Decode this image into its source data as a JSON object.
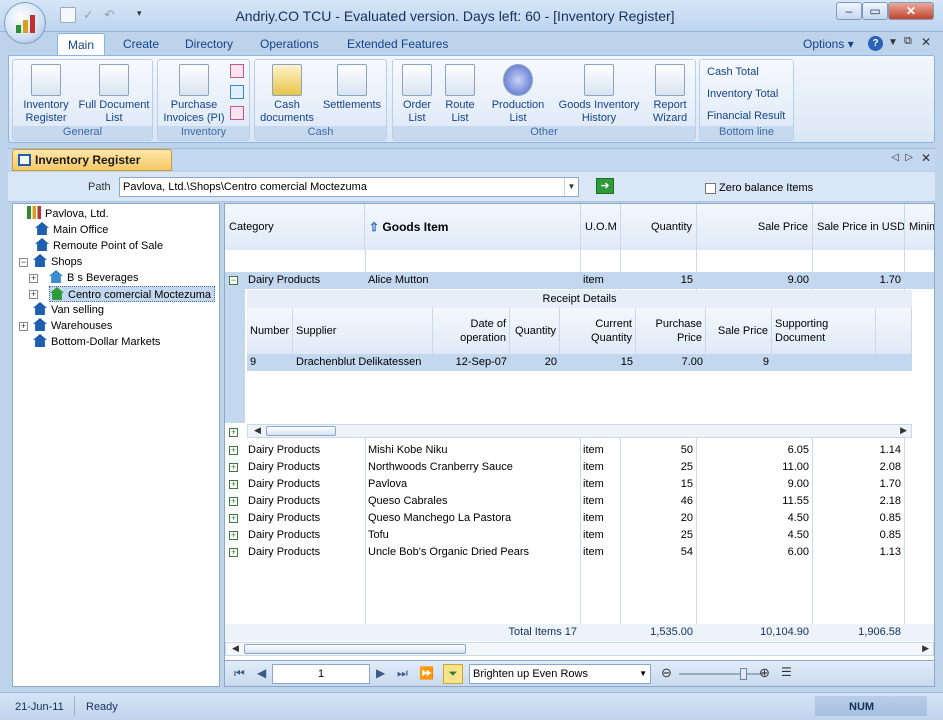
{
  "window": {
    "title": "Andriy.CO TCU - Evaluated version. Days left: 60 - [Inventory Register]"
  },
  "ribbon_tabs": [
    "Main",
    "Create",
    "Directory",
    "Operations",
    "Extended Features"
  ],
  "options_label": "Options",
  "groups": {
    "general": {
      "label": "General",
      "buttons": [
        "Inventory Register",
        "Full Document List"
      ]
    },
    "inventory": {
      "label": "Inventory",
      "buttons": [
        "Purchase Invoices (PI)"
      ]
    },
    "cash": {
      "label": "Cash",
      "buttons": [
        "Cash documents",
        "Settlements"
      ]
    },
    "other": {
      "label": "Other",
      "buttons": [
        "Order List",
        "Route List",
        "Production List",
        "Goods Inventory History",
        "Report Wizard"
      ]
    },
    "bottom_line": {
      "label": "Bottom line",
      "links": [
        "Cash Total",
        "Inventory Total",
        "Financial Result"
      ]
    }
  },
  "doc_tab": "Inventory Register",
  "path": {
    "label": "Path",
    "value": "Pavlova, Ltd.\\Shops\\Centro comercial Moctezuma"
  },
  "zero_balance_label": "Zero balance Items",
  "tree": [
    {
      "label": "Pavlova, Ltd.",
      "level": 0,
      "expander": ""
    },
    {
      "label": "Main Office",
      "level": 1,
      "expander": ""
    },
    {
      "label": "Remoute Point of Sale",
      "level": 1,
      "expander": ""
    },
    {
      "label": "Shops",
      "level": 0,
      "expander": "−"
    },
    {
      "label": "B s Beverages",
      "level": 1,
      "expander": "+"
    },
    {
      "label": "Centro comercial Moctezuma",
      "level": 1,
      "expander": "+",
      "selected": true
    },
    {
      "label": "Van selling",
      "level": 0,
      "expander": ""
    },
    {
      "label": "Warehouses",
      "level": 0,
      "expander": "+"
    },
    {
      "label": "Bottom-Dollar Markets",
      "level": 0,
      "expander": ""
    }
  ],
  "grid": {
    "columns": [
      "Category",
      "Goods Item",
      "U.O.M",
      "Quantity",
      "Sale Price",
      "Sale Price in USD",
      "Minim"
    ],
    "expanded_row": [
      "Dairy Products",
      "Alice Mutton",
      "item",
      "15",
      "9.00",
      "1.70"
    ],
    "detail": {
      "title": "Receipt Details",
      "columns": [
        "Number",
        "Supplier",
        "Date of operation",
        "Quantity",
        "Current Quantity",
        "Purchase Price",
        "Sale Price",
        "Supporting Document"
      ],
      "row": [
        "9",
        "Drachenblut Delikatessen",
        "12-Sep-07",
        "20",
        "15",
        "7.00",
        "9",
        ""
      ]
    },
    "rows": [
      [
        "Dairy Products",
        "Mishi Kobe Niku",
        "item",
        "50",
        "6.05",
        "1.14"
      ],
      [
        "Dairy Products",
        "Northwoods Cranberry Sauce",
        "item",
        "25",
        "11.00",
        "2.08"
      ],
      [
        "Dairy Products",
        "Pavlova",
        "item",
        "15",
        "9.00",
        "1.70"
      ],
      [
        "Dairy Products",
        "Queso Cabrales",
        "item",
        "46",
        "11.55",
        "2.18"
      ],
      [
        "Dairy Products",
        "Queso Manchego La Pastora",
        "item",
        "20",
        "4.50",
        "0.85"
      ],
      [
        "Dairy Products",
        "Tofu",
        "item",
        "25",
        "4.50",
        "0.85"
      ],
      [
        "Dairy Products",
        "Uncle Bob's Organic Dried Pears",
        "item",
        "54",
        "6.00",
        "1.13"
      ]
    ],
    "totals": {
      "label": "Total Items 17",
      "quantity": "1,535.00",
      "sale_price": "10,104.90",
      "sale_usd": "1,906.58"
    }
  },
  "nav": {
    "page": "1",
    "row_style": "Brighten up Even Rows"
  },
  "status": {
    "date": "21-Jun-11",
    "state": "Ready",
    "num": "NUM"
  }
}
